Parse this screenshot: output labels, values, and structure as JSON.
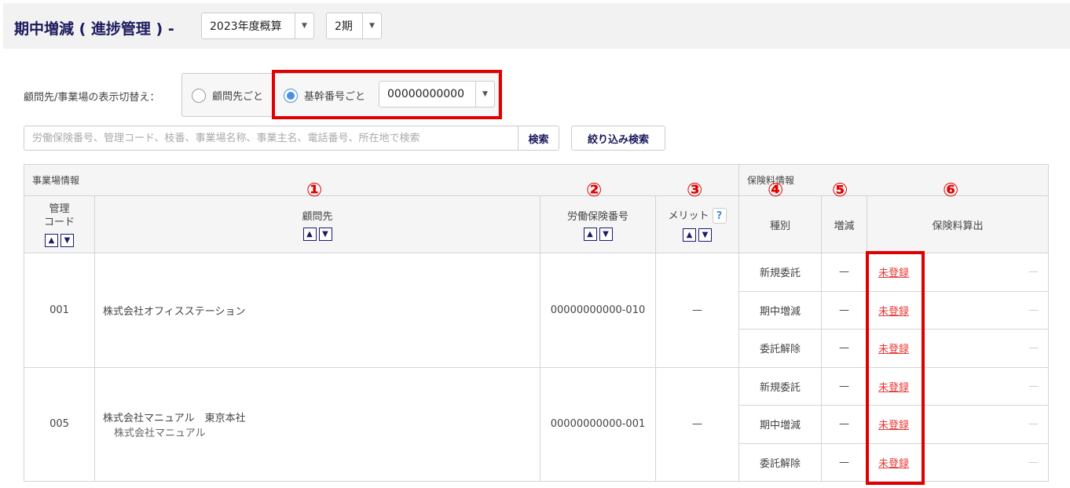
{
  "header": {
    "title": "期中増減 ( 進捗管理 ) -",
    "year_select": "2023年度概算",
    "period_select": "2期"
  },
  "filter": {
    "label": "顧問先/事業場の表示切替え：",
    "radio_client": "顧問先ごと",
    "radio_base": "基幹番号ごと",
    "base_number": "00000000000"
  },
  "search": {
    "placeholder": "労働保険番号、管理コード、枝番、事業場名称、事業主名、電話番号、所在地で検索",
    "button": "検索",
    "filter_button": "絞り込み検索"
  },
  "table": {
    "group1": "事業場情報",
    "group2": "保険料情報",
    "cols": {
      "code": "管理\nコード",
      "client": "顧問先",
      "labor_no": "労働保険番号",
      "merit": "メリット",
      "type": "種別",
      "change": "増減",
      "calc": "保険料算出"
    },
    "help": "?",
    "rows": [
      {
        "code": "001",
        "client": "株式会社オフィスステーション",
        "client_sub": "",
        "labor_no": "00000000000-010",
        "merit": "—",
        "items": [
          {
            "type": "新規委託",
            "change": "—",
            "calc": "未登録",
            "extra": "—"
          },
          {
            "type": "期中増減",
            "change": "—",
            "calc": "未登録",
            "extra": "—"
          },
          {
            "type": "委託解除",
            "change": "—",
            "calc": "未登録",
            "extra": "—"
          }
        ]
      },
      {
        "code": "005",
        "client": "株式会社マニュアル　東京本社",
        "client_sub": "株式会社マニュアル",
        "labor_no": "00000000000-001",
        "merit": "—",
        "items": [
          {
            "type": "新規委託",
            "change": "—",
            "calc": "未登録",
            "extra": "—"
          },
          {
            "type": "期中増減",
            "change": "—",
            "calc": "未登録",
            "extra": "—"
          },
          {
            "type": "委託解除",
            "change": "—",
            "calc": "未登録",
            "extra": "—"
          }
        ]
      }
    ]
  },
  "callouts": [
    "①",
    "②",
    "③",
    "④",
    "⑤",
    "⑥"
  ],
  "colors": {
    "accent": "#1a1a5e",
    "highlight": "#e00000",
    "link": "#e53935"
  }
}
